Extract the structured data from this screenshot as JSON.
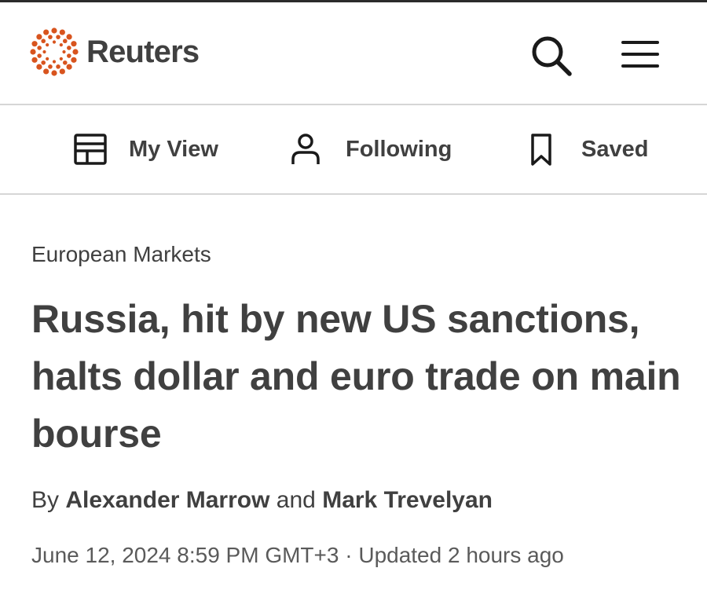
{
  "brand": {
    "name": "Reuters",
    "accent_color": "#d8541e",
    "logo_icon": "reuters-dots-logo"
  },
  "header": {
    "search_icon": "search-icon",
    "menu_icon": "hamburger-menu-icon"
  },
  "nav": {
    "items": [
      {
        "label": "My View",
        "icon": "layout-grid-icon"
      },
      {
        "label": "Following",
        "icon": "person-icon"
      },
      {
        "label": "Saved",
        "icon": "bookmark-icon"
      }
    ]
  },
  "article": {
    "category": "European Markets",
    "headline": "Russia, hit by new US sanctions, halts dollar and euro trade on main bourse",
    "byline": {
      "prefix": "By",
      "author1": "Alexander Marrow",
      "connector": "and",
      "author2": "Mark Trevelyan"
    },
    "date": "June 12, 2024 8:59 PM GMT+3",
    "separator": "·",
    "updated": "Updated 2 hours ago"
  }
}
